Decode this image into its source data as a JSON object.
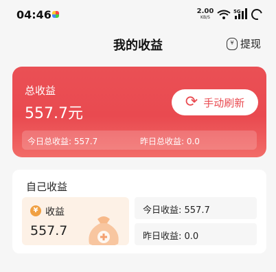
{
  "status": {
    "time": "04:46",
    "speed_value": "2.00",
    "speed_unit": "KB/S",
    "network": "5G"
  },
  "header": {
    "title": "我的收益",
    "withdraw_label": "提现"
  },
  "total_card": {
    "label": "总收益",
    "value": "557.7元",
    "refresh_label": "手动刷新",
    "today_total": "今日总收益: 557.7",
    "yesterday_total": "昨日总收益: 0.0"
  },
  "own_card": {
    "title": "自己收益",
    "income_label": "收益",
    "income_value": "557.7",
    "today": "今日收益: 557.7",
    "yesterday": "昨日收益: 0.0"
  },
  "colors": {
    "accent": "#e94a50",
    "coin": "#f0a043",
    "panel": "#fdf1e6"
  }
}
